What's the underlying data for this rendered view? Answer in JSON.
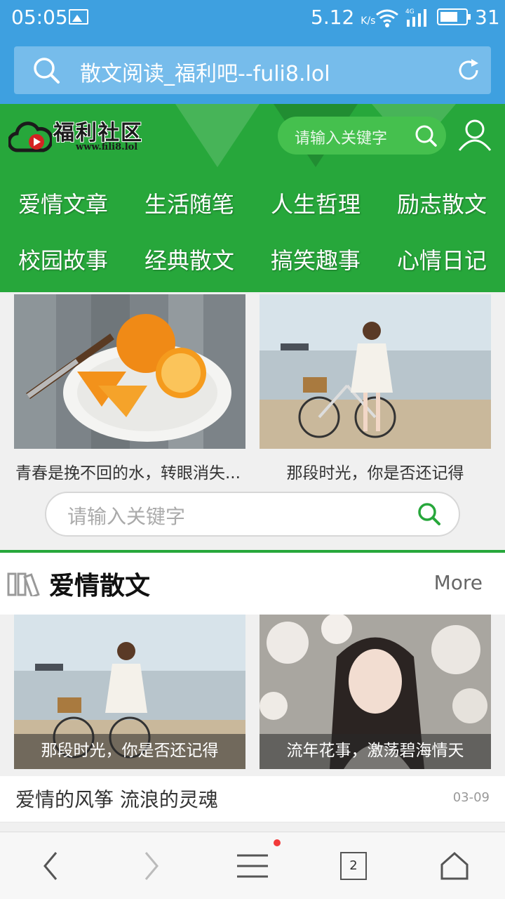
{
  "status_bar": {
    "time": "05:05",
    "net_speed": "5.12",
    "net_speed_unit": "K/s",
    "network_type": "4G",
    "battery_level": "31"
  },
  "browser": {
    "address_text": "散文阅读_福利吧--fuli8.lol"
  },
  "site_header": {
    "logo_text": "福利社区",
    "logo_url": "www.fili8.lol",
    "search_placeholder": "请输入关键字"
  },
  "categories": [
    "爱情文章",
    "生活随笔",
    "人生哲理",
    "励志散文",
    "校园故事",
    "经典散文",
    "搞笑趣事",
    "心情日记"
  ],
  "featured": [
    {
      "caption": "青春是挽不回的水，转眼消失..."
    },
    {
      "caption": "那段时光，你是否还记得"
    }
  ],
  "mid_search": {
    "placeholder": "请输入关键字"
  },
  "section": {
    "title": "爱情散文",
    "more_label": "More",
    "cards": [
      {
        "caption": "那段时光，你是否还记得"
      },
      {
        "caption": "流年花事，激荡碧海情天"
      }
    ],
    "articles": [
      {
        "title": "爱情的风筝 流浪的灵魂",
        "date": "03-09"
      }
    ]
  },
  "bottom_nav": {
    "tab_count": "2"
  },
  "colors": {
    "browser_blue": "#3ea0e0",
    "site_green": "#27a73b",
    "notification_red": "#f23a3a"
  }
}
